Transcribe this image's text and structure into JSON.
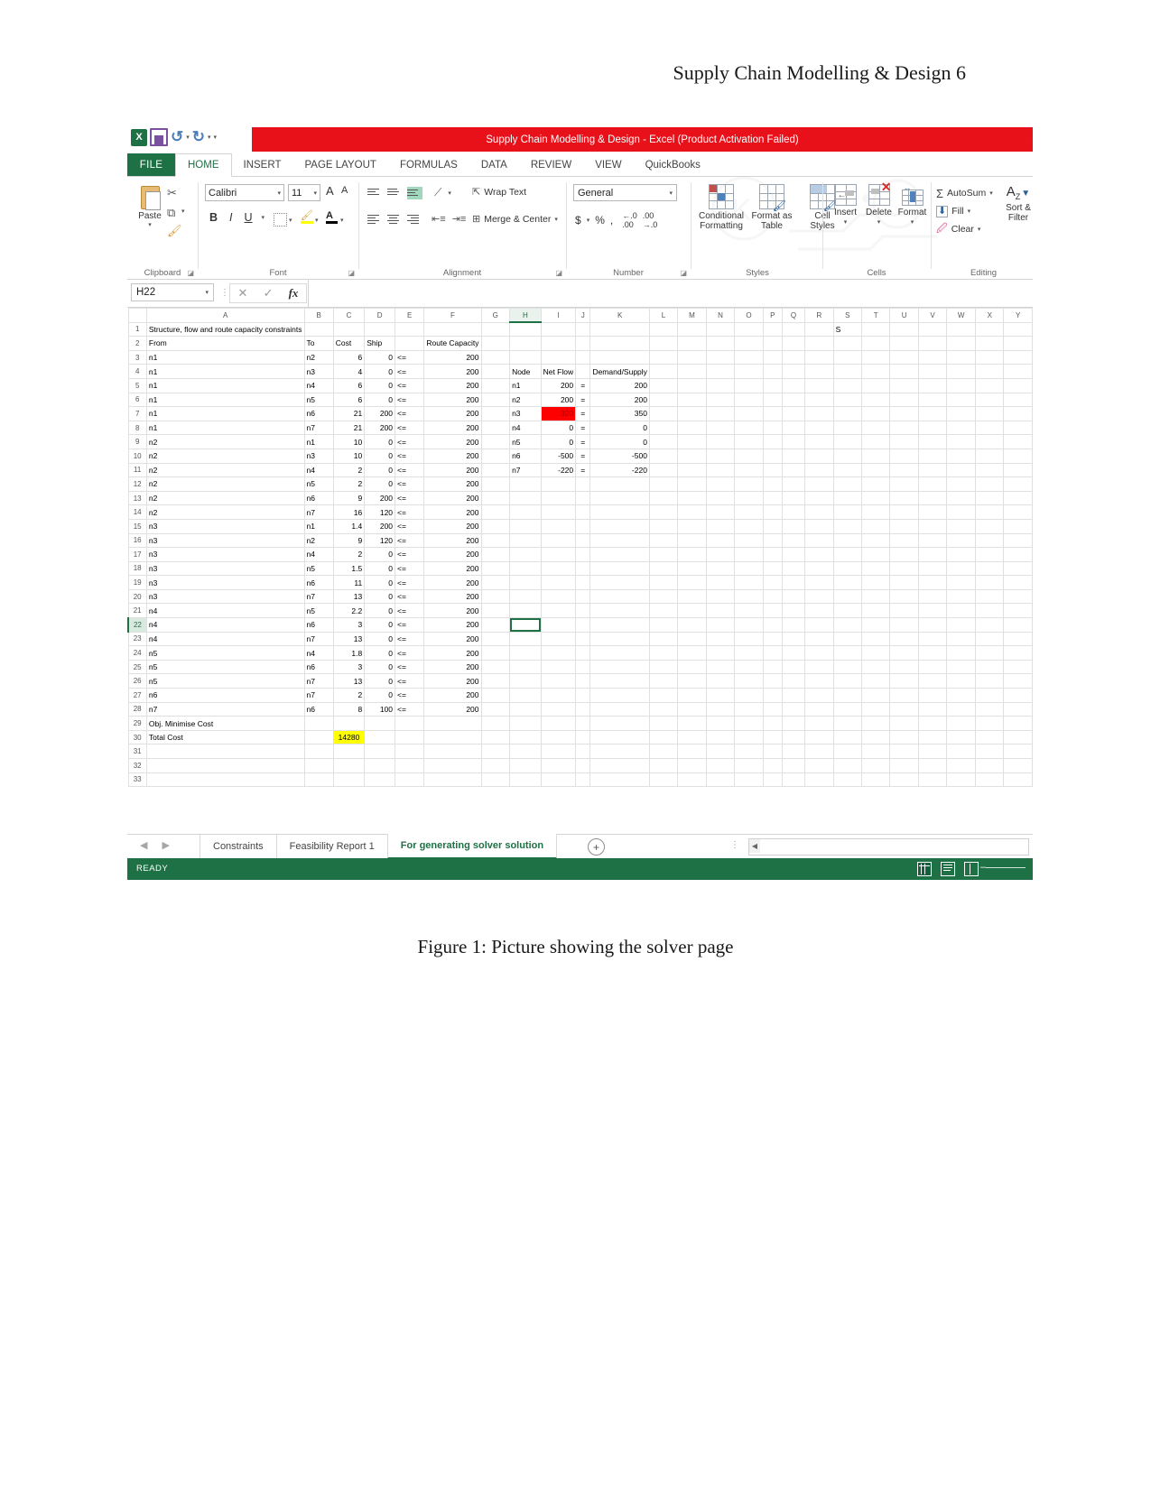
{
  "document": {
    "header": "Supply Chain Modelling & Design 6",
    "figure_caption": "Figure 1: Picture showing the solver page"
  },
  "window": {
    "title": "Supply Chain Modelling & Design -  Excel (Product Activation Failed)",
    "help_glyph": "?",
    "quick_access": {
      "excel_logo": "X",
      "save": "save-icon",
      "undo": "↺",
      "redo": "↻",
      "customize": "▾"
    }
  },
  "ribbon_tabs": {
    "file": "FILE",
    "items": [
      {
        "label": "HOME",
        "active": true
      },
      {
        "label": "INSERT",
        "active": false
      },
      {
        "label": "PAGE LAYOUT",
        "active": false
      },
      {
        "label": "FORMULAS",
        "active": false
      },
      {
        "label": "DATA",
        "active": false
      },
      {
        "label": "REVIEW",
        "active": false
      },
      {
        "label": "VIEW",
        "active": false
      },
      {
        "label": "QuickBooks",
        "active": false
      }
    ]
  },
  "ribbon": {
    "clipboard": {
      "group_label": "Clipboard",
      "paste": "Paste",
      "cut": "cut-icon",
      "copy": "copy-icon",
      "format_painter": "format-painter-icon"
    },
    "font": {
      "group_label": "Font",
      "font_name": "Calibri",
      "font_size": "11",
      "grow": "A",
      "shrink": "A",
      "bold": "B",
      "italic": "I",
      "underline": "U",
      "borders": "borders-icon",
      "fill_color": "fill-color-icon",
      "font_color": "A"
    },
    "alignment": {
      "group_label": "Alignment",
      "wrap_text": "Wrap Text",
      "merge_center": "Merge & Center",
      "orientation": "orientation-icon"
    },
    "number": {
      "group_label": "Number",
      "format": "General",
      "currency": "$",
      "percent": "%",
      "comma": ",",
      "inc_dec": ".00",
      "dec_dec": ".0"
    },
    "styles": {
      "group_label": "Styles",
      "conditional_formatting": "Conditional\nFormatting",
      "conditional_formatting_l1": "Conditional",
      "conditional_formatting_l2": "Formatting",
      "format_as_table_l1": "Format as",
      "format_as_table_l2": "Table",
      "cell_styles_l1": "Cell",
      "cell_styles_l2": "Styles"
    },
    "cells": {
      "group_label": "Cells",
      "insert": "Insert",
      "delete": "Delete",
      "format": "Format"
    },
    "editing": {
      "group_label": "Editing",
      "autosum": "AutoSum",
      "fill": "Fill",
      "clear": "Clear",
      "sort_filter_l1": "Sort &",
      "sort_filter_l2": "Filter"
    }
  },
  "formula_bar": {
    "name_box": "H22",
    "cancel": "✕",
    "enter": "✓",
    "insert_function": "fx",
    "formula_value": ""
  },
  "grid": {
    "columns": [
      "A",
      "B",
      "C",
      "D",
      "E",
      "F",
      "G",
      "H",
      "I",
      "J",
      "K",
      "L",
      "M",
      "N",
      "O",
      "P",
      "Q",
      "R",
      "S",
      "T",
      "U",
      "V",
      "W",
      "X",
      "Y"
    ],
    "selected_column": "H",
    "selected_row": 22,
    "selected_cell": "H22",
    "rows_visible": [
      1,
      2,
      3,
      4,
      5,
      6,
      7,
      8,
      9,
      10,
      11,
      12,
      13,
      14,
      15,
      16,
      17,
      18,
      19,
      20,
      21,
      22,
      23,
      24,
      25,
      26,
      27,
      28,
      29,
      30,
      31,
      32,
      33
    ],
    "title_row": {
      "row": 1,
      "A": "Structure, flow and route capacity constraints",
      "S": "S"
    },
    "left_table": {
      "headers": {
        "A": "From",
        "B": "To",
        "C": "Cost",
        "D": "Ship",
        "E": "",
        "F": "Route Capacity"
      },
      "rows": [
        {
          "row": 3,
          "from": "n1",
          "to": "n2",
          "cost": "6",
          "ship": "0",
          "op": "<=",
          "cap": "200"
        },
        {
          "row": 4,
          "from": "n1",
          "to": "n3",
          "cost": "4",
          "ship": "0",
          "op": "<=",
          "cap": "200"
        },
        {
          "row": 5,
          "from": "n1",
          "to": "n4",
          "cost": "6",
          "ship": "0",
          "op": "<=",
          "cap": "200"
        },
        {
          "row": 6,
          "from": "n1",
          "to": "n5",
          "cost": "6",
          "ship": "0",
          "op": "<=",
          "cap": "200"
        },
        {
          "row": 7,
          "from": "n1",
          "to": "n6",
          "cost": "21",
          "ship": "200",
          "op": "<=",
          "cap": "200"
        },
        {
          "row": 8,
          "from": "n1",
          "to": "n7",
          "cost": "21",
          "ship": "200",
          "op": "<=",
          "cap": "200"
        },
        {
          "row": 9,
          "from": "n2",
          "to": "n1",
          "cost": "10",
          "ship": "0",
          "op": "<=",
          "cap": "200"
        },
        {
          "row": 10,
          "from": "n2",
          "to": "n3",
          "cost": "10",
          "ship": "0",
          "op": "<=",
          "cap": "200"
        },
        {
          "row": 11,
          "from": "n2",
          "to": "n4",
          "cost": "2",
          "ship": "0",
          "op": "<=",
          "cap": "200"
        },
        {
          "row": 12,
          "from": "n2",
          "to": "n5",
          "cost": "2",
          "ship": "0",
          "op": "<=",
          "cap": "200"
        },
        {
          "row": 13,
          "from": "n2",
          "to": "n6",
          "cost": "9",
          "ship": "200",
          "op": "<=",
          "cap": "200"
        },
        {
          "row": 14,
          "from": "n2",
          "to": "n7",
          "cost": "16",
          "ship": "120",
          "op": "<=",
          "cap": "200"
        },
        {
          "row": 15,
          "from": "n3",
          "to": "n1",
          "cost": "1.4",
          "ship": "200",
          "op": "<=",
          "cap": "200"
        },
        {
          "row": 16,
          "from": "n3",
          "to": "n2",
          "cost": "9",
          "ship": "120",
          "op": "<=",
          "cap": "200"
        },
        {
          "row": 17,
          "from": "n3",
          "to": "n4",
          "cost": "2",
          "ship": "0",
          "op": "<=",
          "cap": "200"
        },
        {
          "row": 18,
          "from": "n3",
          "to": "n5",
          "cost": "1.5",
          "ship": "0",
          "op": "<=",
          "cap": "200"
        },
        {
          "row": 19,
          "from": "n3",
          "to": "n6",
          "cost": "11",
          "ship": "0",
          "op": "<=",
          "cap": "200"
        },
        {
          "row": 20,
          "from": "n3",
          "to": "n7",
          "cost": "13",
          "ship": "0",
          "op": "<=",
          "cap": "200"
        },
        {
          "row": 21,
          "from": "n4",
          "to": "n5",
          "cost": "2.2",
          "ship": "0",
          "op": "<=",
          "cap": "200"
        },
        {
          "row": 22,
          "from": "n4",
          "to": "n6",
          "cost": "3",
          "ship": "0",
          "op": "<=",
          "cap": "200"
        },
        {
          "row": 23,
          "from": "n4",
          "to": "n7",
          "cost": "13",
          "ship": "0",
          "op": "<=",
          "cap": "200"
        },
        {
          "row": 24,
          "from": "n5",
          "to": "n4",
          "cost": "1.8",
          "ship": "0",
          "op": "<=",
          "cap": "200"
        },
        {
          "row": 25,
          "from": "n5",
          "to": "n6",
          "cost": "3",
          "ship": "0",
          "op": "<=",
          "cap": "200"
        },
        {
          "row": 26,
          "from": "n5",
          "to": "n7",
          "cost": "13",
          "ship": "0",
          "op": "<=",
          "cap": "200"
        },
        {
          "row": 27,
          "from": "n6",
          "to": "n7",
          "cost": "2",
          "ship": "0",
          "op": "<=",
          "cap": "200"
        },
        {
          "row": 28,
          "from": "n7",
          "to": "n6",
          "cost": "8",
          "ship": "100",
          "op": "<=",
          "cap": "200"
        }
      ]
    },
    "objective": {
      "row29_label": "Obj. Minimise Cost",
      "row30_label": "Total Cost",
      "row30_value": "14280",
      "highlight_color": "#ffff00"
    },
    "balance_table": {
      "header_row": 4,
      "headers": {
        "H": "Node",
        "I": "Net Flow",
        "J": "",
        "K": "Demand/Supply"
      },
      "rows": [
        {
          "row": 5,
          "node": "n1",
          "net_flow": "200",
          "op": "=",
          "demand": "200",
          "error": false
        },
        {
          "row": 6,
          "node": "n2",
          "net_flow": "200",
          "op": "=",
          "demand": "200",
          "error": false
        },
        {
          "row": 7,
          "node": "n3",
          "net_flow": "320",
          "op": "=",
          "demand": "350",
          "error": true
        },
        {
          "row": 8,
          "node": "n4",
          "net_flow": "0",
          "op": "=",
          "demand": "0",
          "error": false
        },
        {
          "row": 9,
          "node": "n5",
          "net_flow": "0",
          "op": "=",
          "demand": "0",
          "error": false
        },
        {
          "row": 10,
          "node": "n6",
          "net_flow": "-500",
          "op": "=",
          "demand": "-500",
          "error": false
        },
        {
          "row": 11,
          "node": "n7",
          "net_flow": "-220",
          "op": "=",
          "demand": "-220",
          "error": false
        }
      ],
      "error_color": "#ff0000"
    }
  },
  "sheet_tabs": {
    "prev": "◀",
    "next": "▶",
    "items": [
      {
        "label": "Constraints",
        "active": false
      },
      {
        "label": "Feasibility Report 1",
        "active": false
      },
      {
        "label": "For generating solver solution",
        "active": true
      }
    ],
    "add_sheet": "+"
  },
  "status_bar": {
    "status": "READY",
    "views": [
      "normal-view",
      "page-layout-view",
      "page-break-view"
    ],
    "zoom_minus": "–"
  }
}
